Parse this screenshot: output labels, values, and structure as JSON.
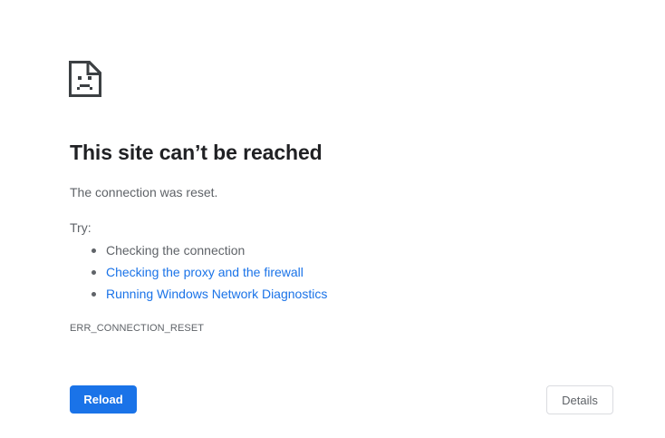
{
  "error_page": {
    "icon": "sad-page-icon",
    "title": "This site can’t be reached",
    "summary": "The connection was reset.",
    "try_label": "Try:",
    "suggestions": [
      {
        "text": "Checking the connection",
        "is_link": false
      },
      {
        "text": "Checking the proxy and the firewall",
        "is_link": true
      },
      {
        "text": "Running Windows Network Diagnostics",
        "is_link": true
      }
    ],
    "error_code": "ERR_CONNECTION_RESET"
  },
  "buttons": {
    "reload_label": "Reload",
    "details_label": "Details"
  },
  "colors": {
    "accent": "#1a73e8",
    "text_primary": "#202124",
    "text_secondary": "#5f6368",
    "border": "#dadce0"
  }
}
